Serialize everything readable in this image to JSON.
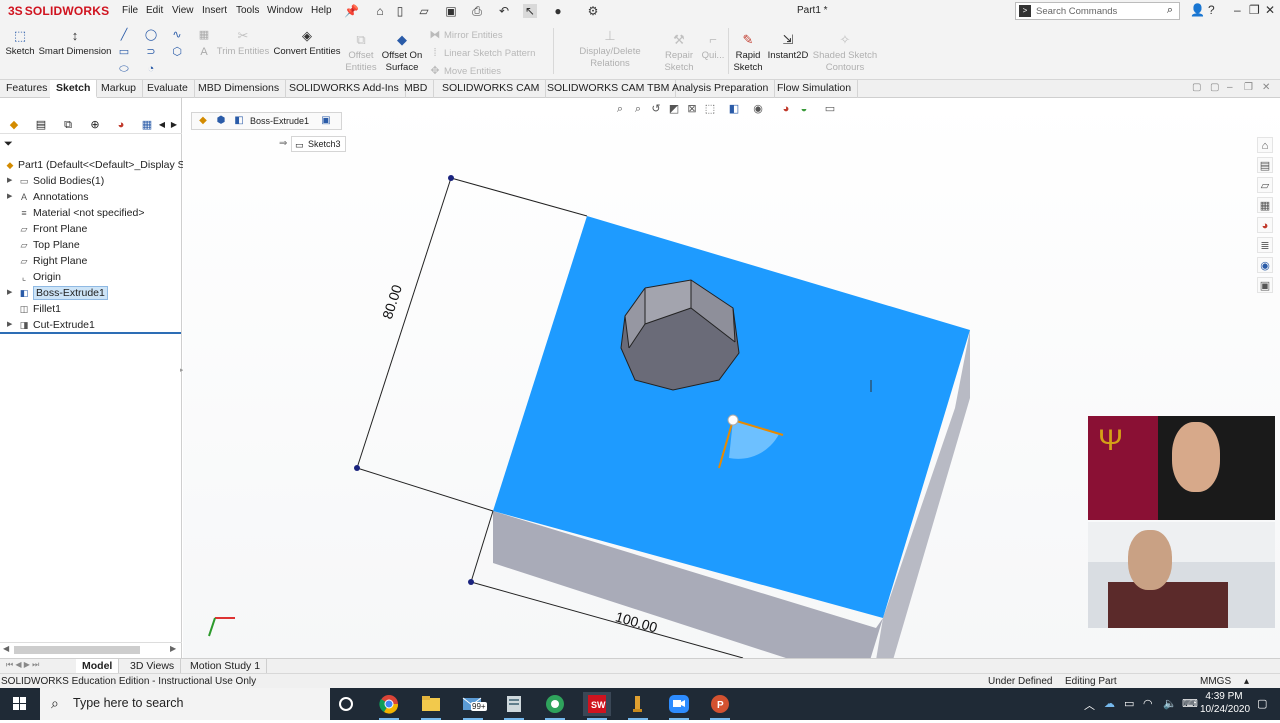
{
  "app": {
    "logo_ds": "3S",
    "logo_text": "SOLIDWORKS",
    "document_title": "Part1 *"
  },
  "menu": [
    "File",
    "Edit",
    "View",
    "Insert",
    "Tools",
    "Window",
    "Help"
  ],
  "search": {
    "placeholder": "Search Commands"
  },
  "ribbon": {
    "sketch": "Sketch",
    "smart_dimension": "Smart Dimension",
    "trim_entities": "Trim Entities",
    "convert_entities": "Convert Entities",
    "offset_entities_1": "Offset",
    "offset_entities_2": "Entities",
    "offset_surface_1": "Offset On",
    "offset_surface_2": "Surface",
    "mirror_entities": "Mirror Entities",
    "linear_pattern": "Linear Sketch Pattern",
    "move_entities": "Move Entities",
    "display_relations": "Display/Delete Relations",
    "quick_snaps": "Qui...",
    "repair_sketch_1": "Repair",
    "repair_sketch_2": "Sketch",
    "rapid_sketch_1": "Rapid",
    "rapid_sketch_2": "Sketch",
    "instant2d": "Instant2D",
    "shaded_contours_1": "Shaded Sketch",
    "shaded_contours_2": "Contours"
  },
  "tabs": [
    "Features",
    "Sketch",
    "Markup",
    "Evaluate",
    "MBD Dimensions",
    "SOLIDWORKS Add-Ins",
    "MBD",
    "SOLIDWORKS CAM",
    "SOLIDWORKS CAM TBM",
    "Analysis Preparation",
    "Flow Simulation"
  ],
  "tree": {
    "root": "Part1  (Default<<Default>_Display S",
    "items": [
      "Solid Bodies(1)",
      "Annotations",
      "Material <not specified>",
      "Front Plane",
      "Top Plane",
      "Right Plane",
      "Origin",
      "Boss-Extrude1",
      "Fillet1",
      "Cut-Extrude1"
    ]
  },
  "viewport": {
    "breadcrumb": "Boss-Extrude1",
    "sketch_crumb": "Sketch3",
    "dim_vertical": "80.00",
    "dim_horizontal": "100.00",
    "face_color": "#1e9bff"
  },
  "model_tabs": [
    "Model",
    "3D Views",
    "Motion Study 1"
  ],
  "status": {
    "edition": "SOLIDWORKS Education Edition - Instructional Use Only",
    "sketch_state": "Under Defined",
    "mode": "Editing Part",
    "units": "MMGS"
  },
  "taskbar": {
    "search_placeholder": "Type here to search",
    "mail_badge": "99+",
    "time": "4:39 PM",
    "date": "10/24/2020"
  }
}
